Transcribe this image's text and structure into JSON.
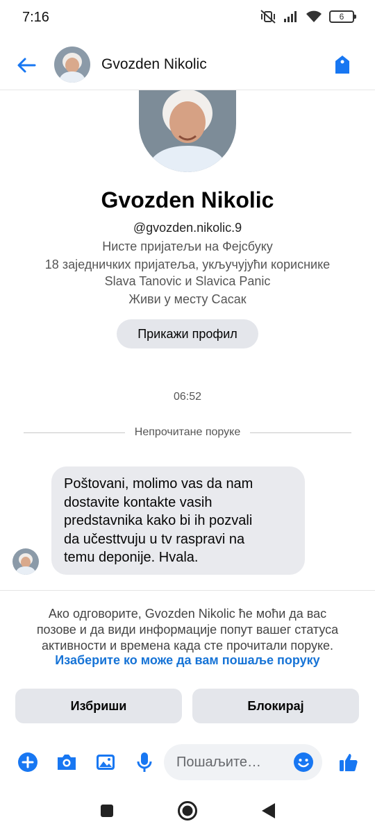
{
  "status_bar": {
    "time": "7:16",
    "battery_level": "6",
    "icons": [
      "mute-vibrate-icon",
      "signal-icon",
      "wifi-icon",
      "battery-icon"
    ]
  },
  "header": {
    "contact_name": "Gvozden Nikolic",
    "icons": [
      "back-arrow-icon",
      "tag-icon"
    ],
    "accent_color": "#1877f2"
  },
  "profile": {
    "name": "Gvozden Nikolic",
    "handle": "@gvozden.nikolic.9",
    "friend_status": "Нисте пријатељи на Фејсбуку",
    "mutual_friends_line1": "18 заједничких пријатеља, укључујући кориснике",
    "mutual_friends_line2": "Slava Tanovic и Slavica Panic",
    "location": "Живи у месту Сасак",
    "view_profile_label": "Прикажи профил"
  },
  "conversation": {
    "timestamp": "06:52",
    "unread_divider": "Непрочитане поруке",
    "messages": [
      {
        "lines": [
          "Poštovani, molimo vas da nam",
          "dostavite kontakte vasih",
          "predstavnika kako bi ih pozvali",
          "da učesttvuju u tv raspravi na",
          "temu deponije. Hvala."
        ],
        "bubble_color": "#e9eaee"
      }
    ]
  },
  "info": {
    "line1": "Ако одговорите, Gvozden Nikolic ће моћи да вас",
    "line2": "позове и да види информације попут вашег статуса",
    "line3": "активности и времена када сте прочитали поруке.",
    "link": "Изаберите ко може да вам пошаље поруку",
    "link_color": "#1673d6"
  },
  "actions": {
    "delete_label": "Избриши",
    "block_label": "Блокирај"
  },
  "composer": {
    "placeholder": "Пошаљите…",
    "icons": [
      "plus-icon",
      "camera-icon",
      "gallery-icon",
      "microphone-icon",
      "emoji-icon",
      "thumbs-up-icon"
    ]
  },
  "system_nav": {
    "icons": [
      "recents-icon",
      "home-icon",
      "back-icon"
    ]
  }
}
